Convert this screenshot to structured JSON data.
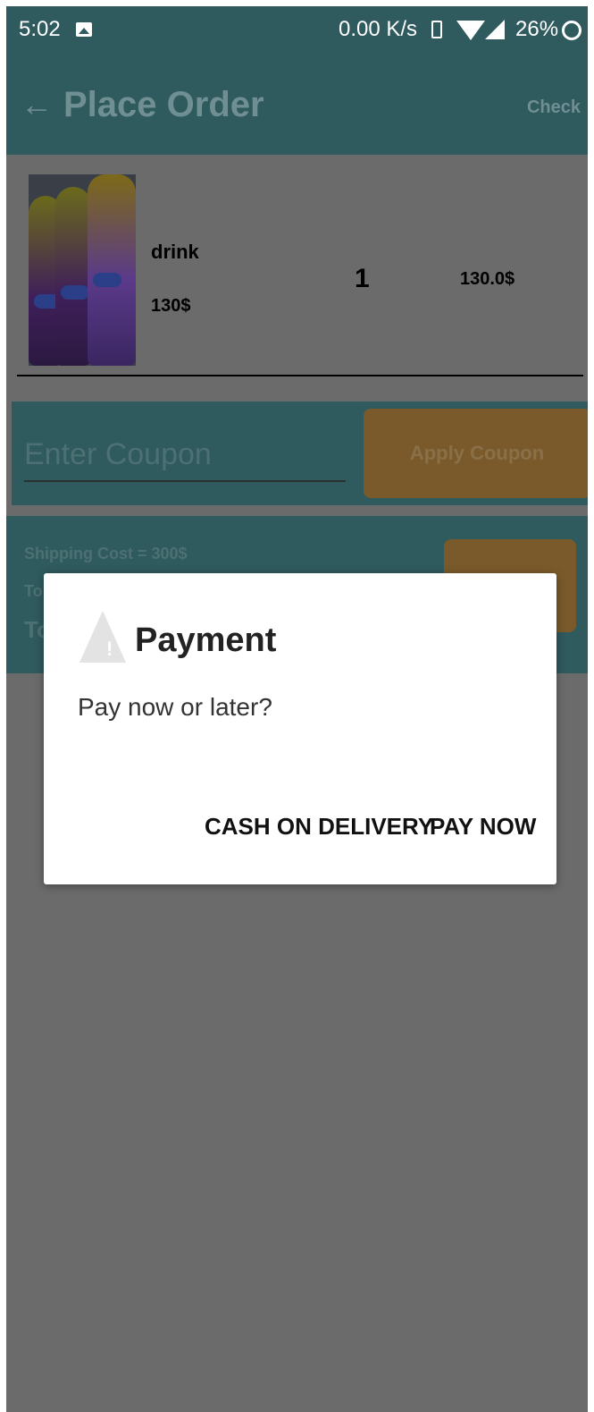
{
  "status_bar": {
    "time": "5:02",
    "network_speed": "0.00 K/s",
    "battery": "26%",
    "icons": [
      "image-icon",
      "vibrate-icon",
      "wifi-icon",
      "signal-icon",
      "battery-icon"
    ]
  },
  "app_bar": {
    "title": "Place Order",
    "check_label": "Check",
    "back_icon": "back-arrow-icon"
  },
  "order_item": {
    "name": "drink",
    "price": "130$",
    "quantity": "1",
    "total": "130.0$"
  },
  "coupon": {
    "placeholder": "Enter Coupon",
    "apply_label": "Apply Coupon"
  },
  "summary": {
    "shipping": "Shipping Cost = 300$",
    "total_partial_1": "To",
    "total_partial_2": "To"
  },
  "dialog": {
    "title": "Payment",
    "message": "Pay now or later?",
    "cash_label": "CASH ON DELIVERY",
    "pay_label": "PAY NOW",
    "icon": "warning-icon"
  },
  "colors": {
    "app_bar": "#2f5a5e",
    "scrim": "#6b6b6b",
    "accent_dimmed": "#7a5a2a",
    "dialog_bg": "#ffffff"
  }
}
